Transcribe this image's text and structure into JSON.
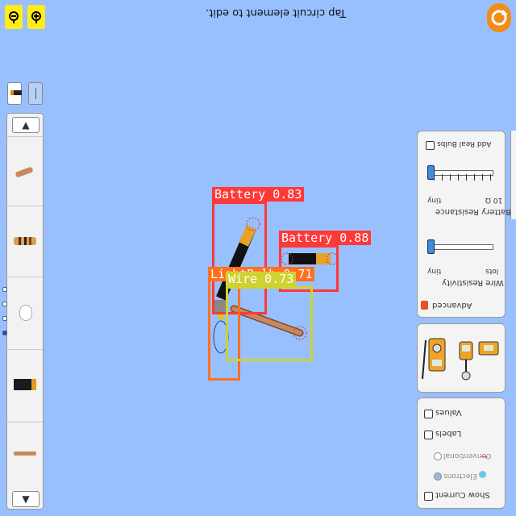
{
  "hint_text": "Tap circuit element to edit.",
  "detections": [
    {
      "label": "Battery 0.83",
      "color": "#ff3838"
    },
    {
      "label": "Battery 0.88",
      "color": "#ff3838"
    },
    {
      "label": "LightBulb 0.71",
      "color": "#ff701f"
    },
    {
      "label": "Wire 0.73",
      "color": "#cfd231"
    }
  ],
  "controls": {
    "add_real_bulbs": "Add Real Bulbs",
    "battery_resistance_label": "Battery Resistance",
    "battery_min": "tiny",
    "battery_max": "10 Ω",
    "wire_resistivity_label": "Wire Resistivity",
    "wire_min": "tiny",
    "wire_max": "lots",
    "advanced": "Advanced"
  },
  "view": {
    "values": "Values",
    "labels": "Labels",
    "conventional": "Conventional",
    "electrons": "Electrons",
    "show_current": "Show Current"
  },
  "icons": [
    "zoom-in-icon",
    "zoom-out-icon",
    "refresh-icon",
    "voltmeter-icon",
    "ammeter-icon",
    "non-contact-ammeter-icon"
  ],
  "colors": {
    "background": "#99c0fe",
    "refresh": "#f28c17",
    "zoom_buttons": "#ffec18"
  }
}
